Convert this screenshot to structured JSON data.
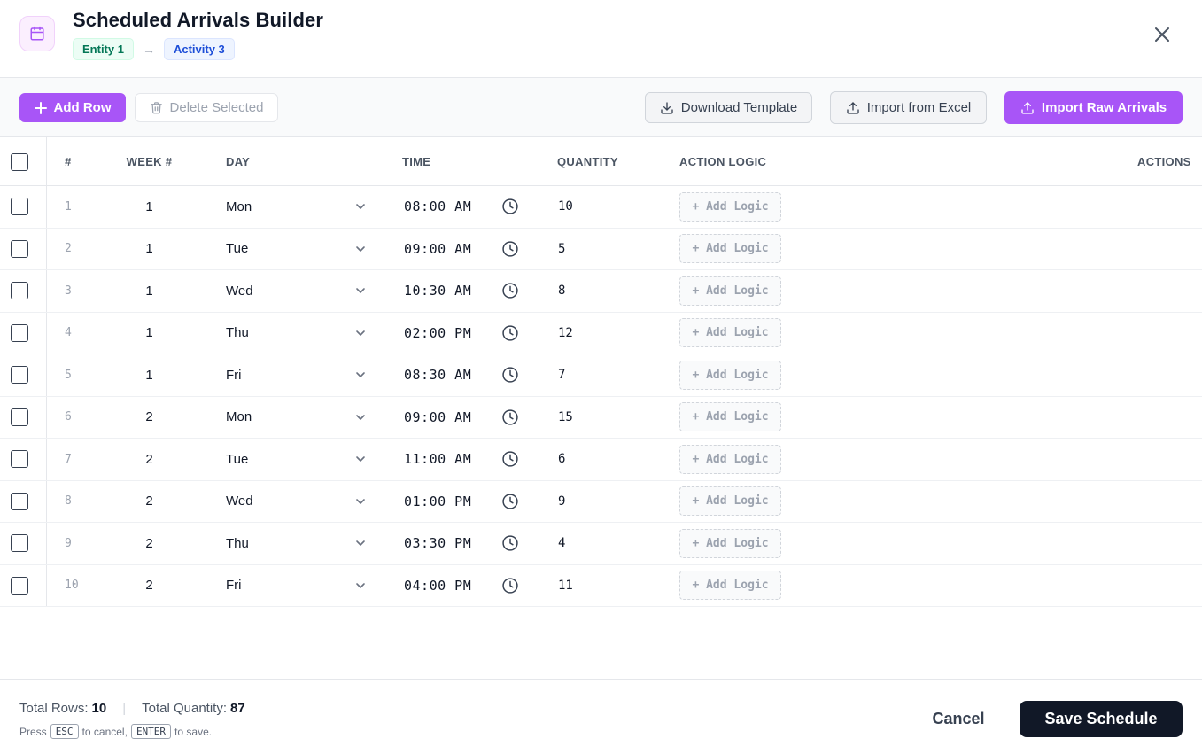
{
  "header": {
    "title": "Scheduled Arrivals Builder",
    "breadcrumb": {
      "entity": "Entity 1",
      "separator": "→",
      "activity": "Activity 3"
    }
  },
  "toolbar": {
    "add_row": "Add Row",
    "delete_selected": "Delete Selected",
    "download_template": "Download Template",
    "import_excel": "Import from Excel",
    "import_raw": "Import Raw Arrivals"
  },
  "table": {
    "columns": {
      "num": "#",
      "week": "WEEK #",
      "day": "DAY",
      "time": "TIME",
      "quantity": "QUANTITY",
      "action_logic": "ACTION LOGIC",
      "actions": "ACTIONS"
    },
    "add_logic_label": "+ Add Logic",
    "rows": [
      {
        "num": "1",
        "week": "1",
        "day": "Mon",
        "time": "08:00 AM",
        "quantity": "10"
      },
      {
        "num": "2",
        "week": "1",
        "day": "Tue",
        "time": "09:00 AM",
        "quantity": "5"
      },
      {
        "num": "3",
        "week": "1",
        "day": "Wed",
        "time": "10:30 AM",
        "quantity": "8"
      },
      {
        "num": "4",
        "week": "1",
        "day": "Thu",
        "time": "02:00 PM",
        "quantity": "12"
      },
      {
        "num": "5",
        "week": "1",
        "day": "Fri",
        "time": "08:30 AM",
        "quantity": "7"
      },
      {
        "num": "6",
        "week": "2",
        "day": "Mon",
        "time": "09:00 AM",
        "quantity": "15"
      },
      {
        "num": "7",
        "week": "2",
        "day": "Tue",
        "time": "11:00 AM",
        "quantity": "6"
      },
      {
        "num": "8",
        "week": "2",
        "day": "Wed",
        "time": "01:00 PM",
        "quantity": "9"
      },
      {
        "num": "9",
        "week": "2",
        "day": "Thu",
        "time": "03:30 PM",
        "quantity": "4"
      },
      {
        "num": "10",
        "week": "2",
        "day": "Fri",
        "time": "04:00 PM",
        "quantity": "11"
      }
    ]
  },
  "footer": {
    "total_rows_label": "Total Rows:",
    "total_rows_value": "10",
    "total_quantity_label": "Total Quantity:",
    "total_quantity_value": "87",
    "hint": {
      "press": "Press",
      "esc": "ESC",
      "to_cancel": "to cancel,",
      "enter": "ENTER",
      "to_save": "to save."
    },
    "cancel": "Cancel",
    "save": "Save Schedule"
  },
  "colors": {
    "accent": "#a855f7",
    "dark": "#111827",
    "entity_green": "#047857",
    "activity_blue": "#1d4ed8"
  },
  "icons": {
    "header": "calendar-icon",
    "close": "close-icon",
    "add": "plus-icon",
    "delete": "trash-icon",
    "download": "download-icon",
    "upload": "upload-icon",
    "day_select": "chevron-down-icon",
    "time_picker": "clock-icon"
  }
}
